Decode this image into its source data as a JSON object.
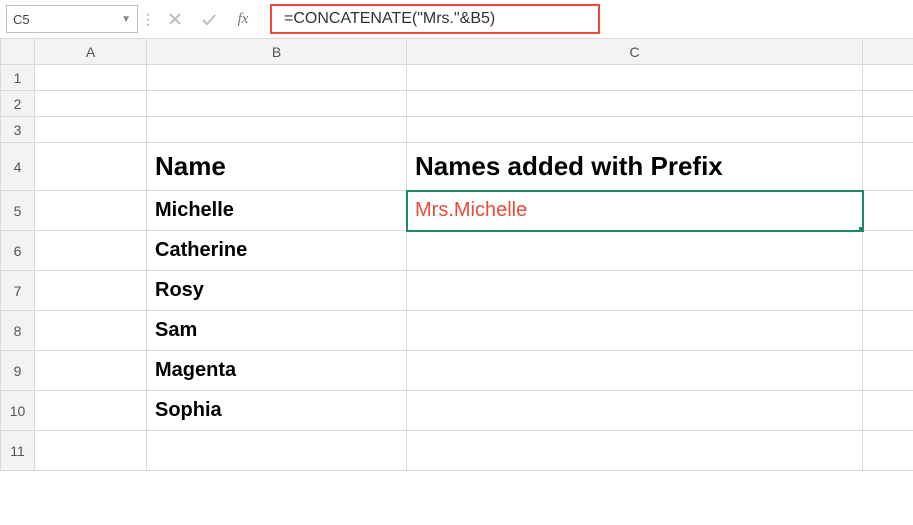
{
  "formula_bar": {
    "name_box": "C5",
    "formula": "=CONCATENATE(\"Mrs.\"&B5)",
    "fx_label": "fx"
  },
  "columns": [
    "A",
    "B",
    "C"
  ],
  "row_headers": [
    "1",
    "2",
    "3",
    "4",
    "5",
    "6",
    "7",
    "8",
    "9",
    "10",
    "11"
  ],
  "active_cell": {
    "col": "C",
    "row": "5"
  },
  "headers": {
    "B4": "Name",
    "C4": "Names added with Prefix"
  },
  "names": [
    "Michelle",
    "Catherine",
    "Rosy",
    "Sam",
    "Magenta",
    "Sophia"
  ],
  "result": {
    "C5": "Mrs.Michelle"
  },
  "chart_data": {
    "type": "table",
    "columns": [
      "Name",
      "Names added with Prefix"
    ],
    "rows": [
      [
        "Michelle",
        "Mrs.Michelle"
      ],
      [
        "Catherine",
        ""
      ],
      [
        "Rosy",
        ""
      ],
      [
        "Sam",
        ""
      ],
      [
        "Magenta",
        ""
      ],
      [
        "Sophia",
        ""
      ]
    ]
  }
}
